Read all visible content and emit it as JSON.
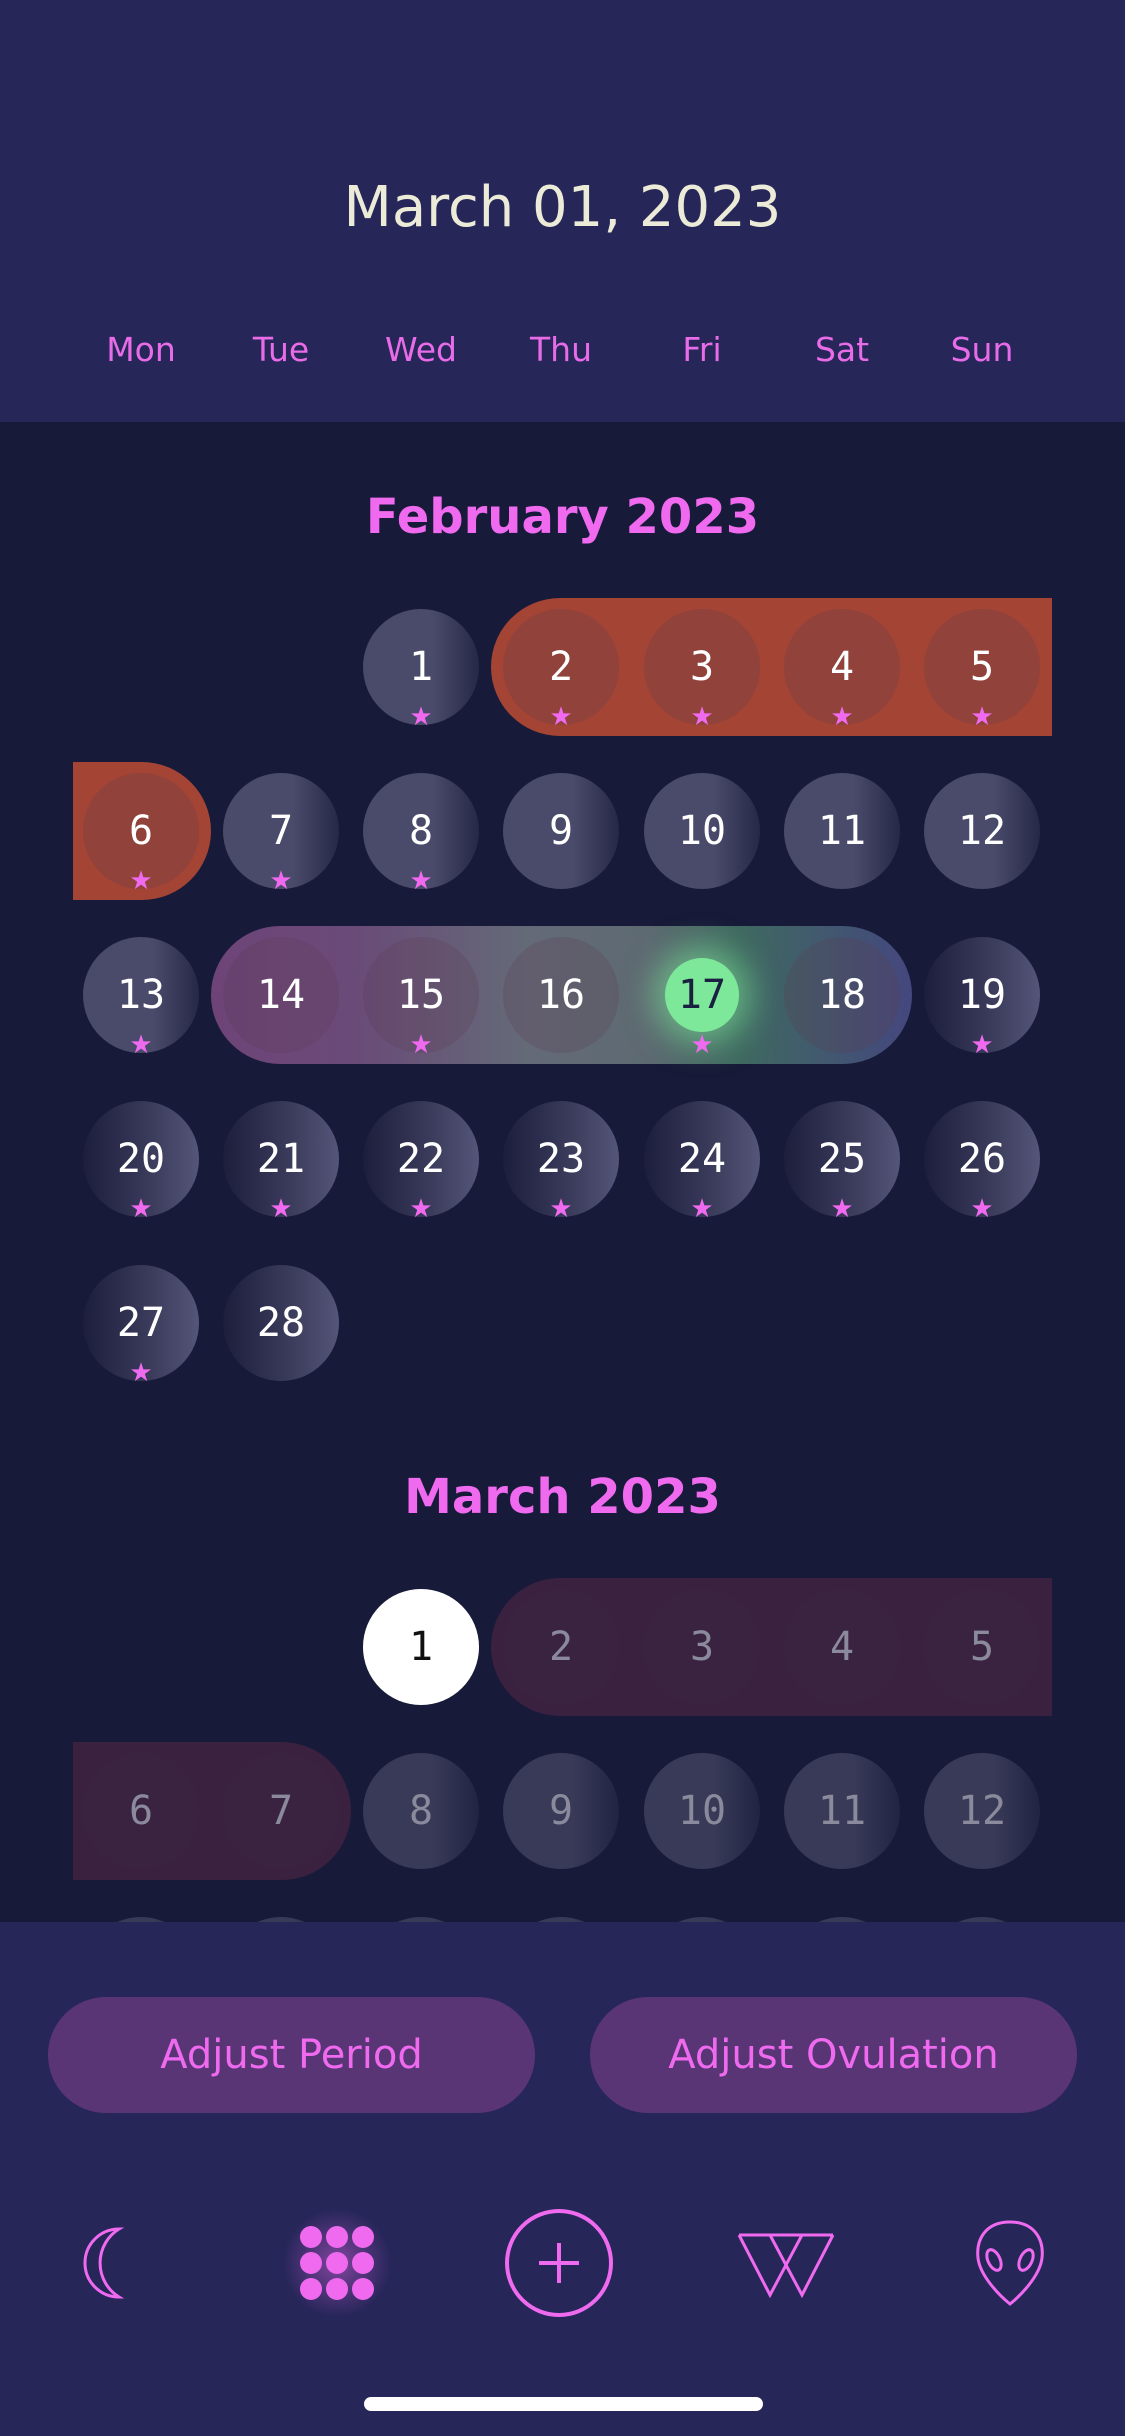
{
  "header": {
    "title": "March 01, 2023",
    "weekdays": [
      "Mon",
      "Tue",
      "Wed",
      "Thu",
      "Fri",
      "Sat",
      "Sun"
    ]
  },
  "months": [
    {
      "title": "February 2023",
      "days_in_month": 28,
      "first_weekday": "Wed",
      "star_days": [
        1,
        2,
        3,
        4,
        5,
        6,
        7,
        8,
        13,
        15,
        17,
        19,
        20,
        21,
        22,
        23,
        24,
        25,
        26,
        27
      ],
      "period_days": [
        2,
        3,
        4,
        5,
        6
      ],
      "fertile_days": [
        14,
        15,
        16,
        17,
        18
      ],
      "ovulation_day": 17,
      "future": false
    },
    {
      "title": "March 2023",
      "days_in_month": 31,
      "first_weekday": "Wed",
      "today": 1,
      "star_days": [],
      "period_days": [
        2,
        3,
        4,
        5,
        6,
        7
      ],
      "fertile_days": [],
      "future": true
    }
  ],
  "actions": {
    "adjust_period": "Adjust Period",
    "adjust_ovulation": "Adjust Ovulation"
  },
  "nav": {
    "items": [
      {
        "icon": "moon-icon"
      },
      {
        "icon": "calendar-grid-icon",
        "active": true
      },
      {
        "icon": "add-circle-icon"
      },
      {
        "icon": "w-triangle-icon"
      },
      {
        "icon": "alien-icon"
      }
    ]
  },
  "colors": {
    "accent": "#f06af0",
    "header_bg": "#262659",
    "body_bg": "#171a38",
    "period": "#a34434",
    "period_predicted": "#3a2140",
    "ovulation": "#7ee89a",
    "button_bg": "#5a3575"
  }
}
